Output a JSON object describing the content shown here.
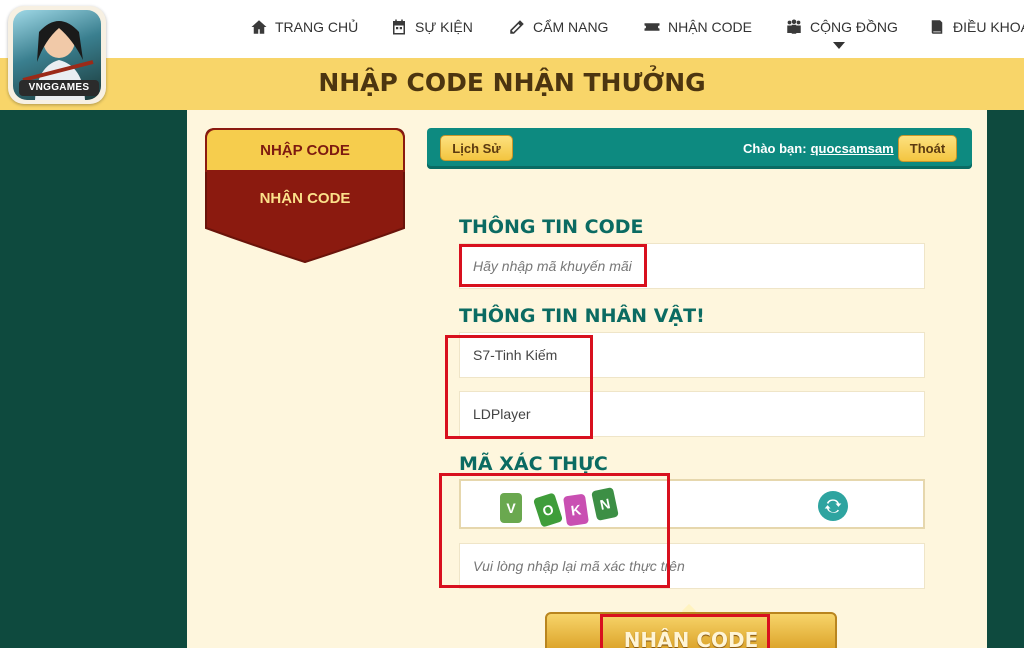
{
  "logo": {
    "brand": "VNGGAMES"
  },
  "nav": {
    "items": [
      {
        "label": "TRANG CHỦ",
        "icon": "home-icon"
      },
      {
        "label": "SỰ KIỆN",
        "icon": "calendar-icon"
      },
      {
        "label": "CẨM NANG",
        "icon": "guide-icon"
      },
      {
        "label": "NHẬN CODE",
        "icon": "ticket-icon"
      },
      {
        "label": "CỘNG ĐỒNG",
        "icon": "community-icon"
      },
      {
        "label": "ĐIỀU KHOẢN",
        "icon": "book-icon"
      }
    ]
  },
  "banner": {
    "title": "NHẬP CODE NHẬN THƯỞNG"
  },
  "sidebar": {
    "tab_enter_code": "NHẬP CODE",
    "tab_receive_code": "NHẬN CODE"
  },
  "userbar": {
    "history_label": "Lịch Sử",
    "greeting": "Chào bạn:",
    "username": "quocsamsam",
    "logout_label": "Thoát"
  },
  "form": {
    "code_title": "THÔNG TIN CODE",
    "code_placeholder": "Hãy nhập mã khuyến mãi",
    "character_title": "THÔNG TIN NHÂN VẬT!",
    "server_value": "S7-Tinh Kiếm",
    "character_value": "LDPlayer",
    "captcha_title": "MÃ XÁC THỰC",
    "captcha_chars": [
      "V",
      "O",
      "K",
      "N"
    ],
    "captcha_placeholder": "Vui lòng nhập lại mã xác thực trên",
    "submit_label": "NHẬN CODE"
  },
  "colors": {
    "accent_teal": "#0d8a80",
    "banner_yellow": "#f8d569",
    "dark_green_bg": "#0e4a3e",
    "maroon": "#8b1a0f",
    "highlight_red": "#d8101e"
  }
}
